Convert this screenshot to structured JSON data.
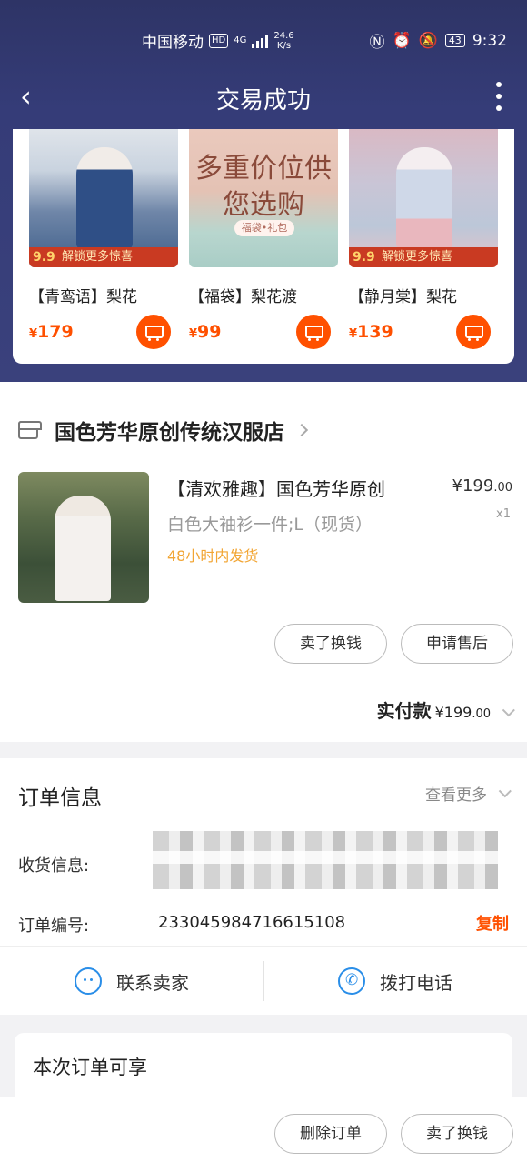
{
  "status_bar": {
    "carrier": "中国移动",
    "hd": "HD",
    "network": "4G",
    "speed_value": "24.6",
    "speed_unit": "K/s",
    "battery": "43",
    "time": "9:32"
  },
  "nav": {
    "title": "交易成功"
  },
  "recommendations": [
    {
      "name": "【青鸾语】梨花",
      "price": "179",
      "banner_num": "9.9",
      "banner_text": "解锁更多惊喜"
    },
    {
      "name": "【福袋】梨花渡",
      "price": "99",
      "promo_text": "多重价位供您选购",
      "promo_pill": "福袋•礼包"
    },
    {
      "name": "【静月棠】梨花",
      "price": "139",
      "banner_num": "9.9",
      "banner_text": "解锁更多惊喜"
    }
  ],
  "currency": "¥",
  "shop": {
    "name": "国色芳华原创传统汉服店"
  },
  "item": {
    "title": "【清欢雅趣】国色芳华原创",
    "price_int": "199",
    "price_dec": ".00",
    "sku": "白色大袖衫一件;L（现货）",
    "qty": "x1",
    "shipping": "48小时内发货"
  },
  "item_buttons": {
    "sell": "卖了换钱",
    "after_sale": "申请售后"
  },
  "payment": {
    "label": "实付款",
    "amount_int": "199",
    "amount_dec": ".00"
  },
  "order_info": {
    "title": "订单信息",
    "more": "查看更多",
    "receiver_label": "收货信息:",
    "order_no_label": "订单编号:",
    "order_no": "2330459847166151​08",
    "copy": "复制"
  },
  "actions": {
    "contact": "联系卖家",
    "call": "拨打电话"
  },
  "benefit": {
    "title": "本次订单可享"
  },
  "bottom_buttons": {
    "delete": "删除订单",
    "sell": "卖了换钱"
  },
  "colors": {
    "header": "#353c78",
    "accent": "#ff5000",
    "ship": "#f2a533",
    "link_blue": "#2a8ee8"
  }
}
